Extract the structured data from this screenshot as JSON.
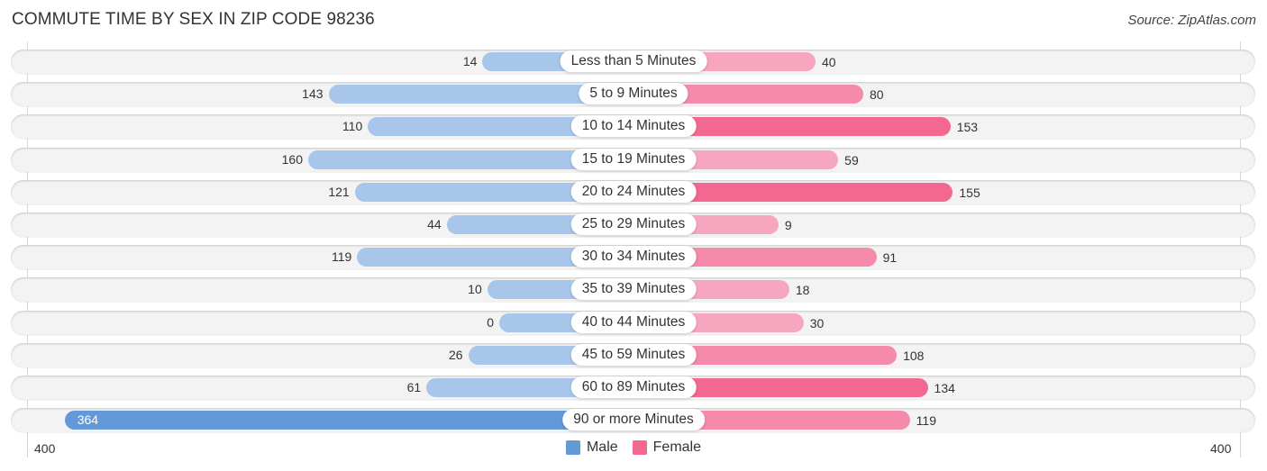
{
  "header": {
    "title": "COMMUTE TIME BY SEX IN ZIP CODE 98236",
    "source": "Source: ZipAtlas.com"
  },
  "colors": {
    "male_strong": "#6399d9",
    "male_light": "#a7c6e9",
    "male_mid": "#8ab4e4",
    "female_strong": "#f26890",
    "female_light": "#f6a7bf",
    "female_mid": "#f58aab"
  },
  "legend": [
    {
      "label": "Male",
      "color": "#6399d9"
    },
    {
      "label": "Female",
      "color": "#f26890"
    }
  ],
  "axis": {
    "left_label": "400",
    "right_label": "400"
  },
  "chart_data": {
    "type": "bar",
    "orientation": "horizontal-diverging",
    "title": "COMMUTE TIME BY SEX IN ZIP CODE 98236",
    "categories": [
      "Less than 5 Minutes",
      "5 to 9 Minutes",
      "10 to 14 Minutes",
      "15 to 19 Minutes",
      "20 to 24 Minutes",
      "25 to 29 Minutes",
      "30 to 34 Minutes",
      "35 to 39 Minutes",
      "40 to 44 Minutes",
      "45 to 59 Minutes",
      "60 to 89 Minutes",
      "90 or more Minutes"
    ],
    "series": [
      {
        "name": "Male",
        "values": [
          14,
          143,
          110,
          160,
          121,
          44,
          119,
          10,
          0,
          26,
          61,
          364
        ]
      },
      {
        "name": "Female",
        "values": [
          40,
          80,
          153,
          59,
          155,
          9,
          91,
          18,
          30,
          108,
          134,
          119
        ]
      }
    ],
    "xlim": [
      -400,
      400
    ],
    "tick_labels": [
      "400",
      "400"
    ],
    "legend_position": "bottom-center",
    "grid": false
  }
}
